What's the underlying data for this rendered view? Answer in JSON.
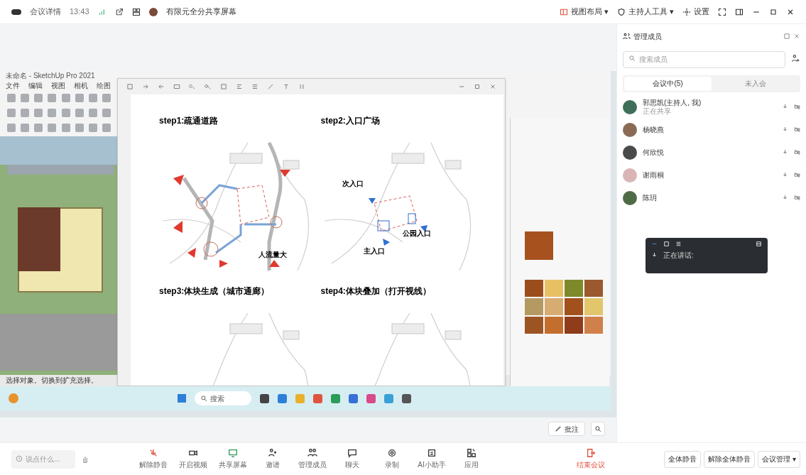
{
  "top_bar": {
    "app_name": "会议详情",
    "time": "13:43",
    "meeting_title": "有限元全分共享屏幕",
    "layout": "视图布局 ▾",
    "host_tools": "主持人工具 ▾",
    "settings": "设置"
  },
  "sketchup": {
    "title": "未命名 - SketchUp Pro 2021",
    "menus": [
      "文件",
      "编辑",
      "视图",
      "相机",
      "绘图"
    ],
    "status": "选择对象。切换到扩充选择。"
  },
  "viewer": {
    "panels": [
      {
        "title": "step1:疏通道路",
        "kind": "roads",
        "labels": [
          "人流量大"
        ]
      },
      {
        "title": "step2:入口广场",
        "kind": "entries",
        "labels": [
          "次入口",
          "公园入口",
          "主入口"
        ]
      },
      {
        "title": "step3:体块生成（城市通廊）",
        "kind": "mass"
      },
      {
        "title": "step4:体块叠加（打开视线）",
        "kind": "stack"
      }
    ]
  },
  "taskbar": {
    "search": "搜索"
  },
  "speaking_widget": {
    "label": "正在讲话:"
  },
  "annotate": "批注",
  "members_panel": {
    "title": "管理成员",
    "search": {
      "placeholder": "搜索成员"
    },
    "tabs": [
      {
        "label": "会议中(5)",
        "selected": true
      },
      {
        "label": "未入会",
        "selected": false
      }
    ],
    "members": [
      {
        "name": "郭思凯(主持人, 我)",
        "note": "正在共享",
        "color": "#3f6f5a"
      },
      {
        "name": "杨晓燕",
        "color": "#8a6a55"
      },
      {
        "name": "何欣悦",
        "color": "#4a4a4a"
      },
      {
        "name": "谢雨桐",
        "color": "#d9b5b5"
      },
      {
        "name": "陈玥",
        "color": "#4f6b45"
      }
    ]
  },
  "chat": {
    "placeholder": "说点什么..."
  },
  "toolbar": [
    {
      "label": "解除静音",
      "kind": "mic"
    },
    {
      "label": "开启视频",
      "kind": "video"
    },
    {
      "label": "共享屏幕",
      "kind": "share"
    },
    {
      "label": "邀请",
      "kind": "invite"
    },
    {
      "label": "管理成员",
      "kind": "members"
    },
    {
      "label": "聊天",
      "kind": "chat"
    },
    {
      "label": "录制",
      "kind": "record"
    },
    {
      "label": "AI小助手",
      "kind": "ai"
    },
    {
      "label": "应用",
      "kind": "apps"
    }
  ],
  "end_button": "结束会议",
  "host_buttons": [
    "全体静音",
    "解除全体静音",
    "会议管理 ▾"
  ]
}
